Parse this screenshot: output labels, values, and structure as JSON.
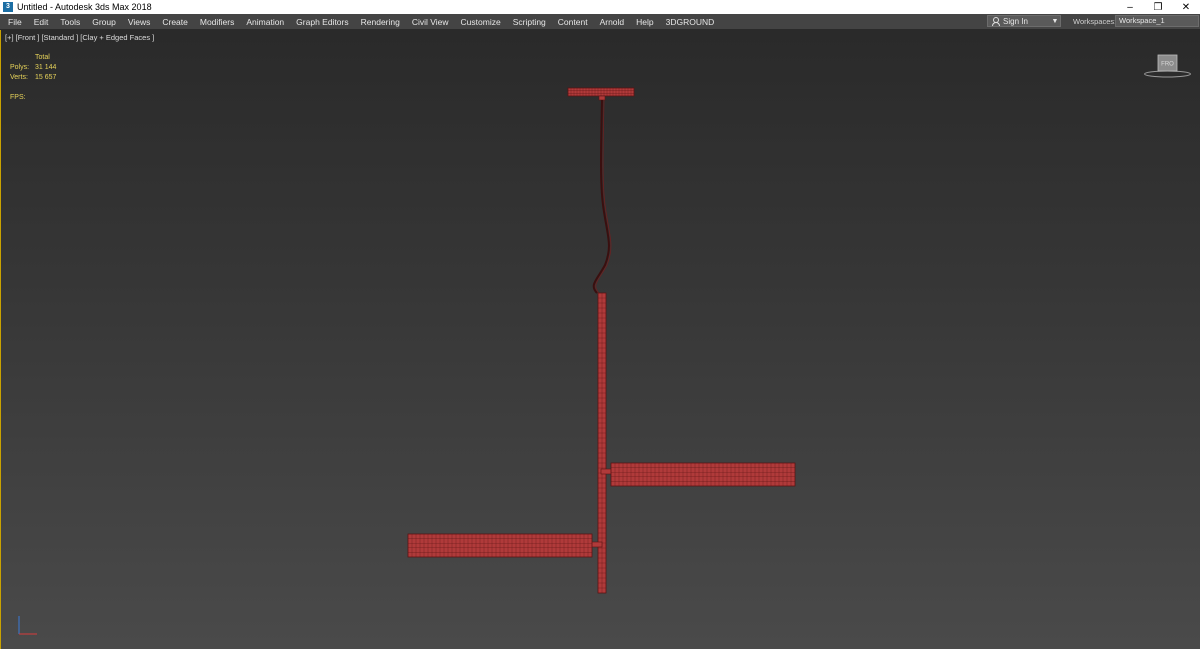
{
  "window": {
    "title": "Untitled - Autodesk 3ds Max 2018",
    "minimize": "–",
    "restore": "❐",
    "close": "✕"
  },
  "menu": {
    "items": [
      "File",
      "Edit",
      "Tools",
      "Group",
      "Views",
      "Create",
      "Modifiers",
      "Animation",
      "Graph Editors",
      "Rendering",
      "Civil View",
      "Customize",
      "Scripting",
      "Content",
      "Arnold",
      "Help",
      "3DGROUND"
    ]
  },
  "account": {
    "signin_label": "Sign In",
    "workspaces_label": "Workspaces:",
    "workspace_value": "Workspace_1"
  },
  "viewport": {
    "label": "[+] [Front ] [Standard ] [Clay + Edged Faces ]",
    "stats": {
      "total_label": "Total",
      "polys_label": "Polys:",
      "polys_value": "31 144",
      "verts_label": "Verts:",
      "verts_value": "15 657",
      "fps_label": "FPS:"
    },
    "viewcube_face": "FRO",
    "model_color": "#b03a3a",
    "model_edge_color": "#5a1414"
  }
}
